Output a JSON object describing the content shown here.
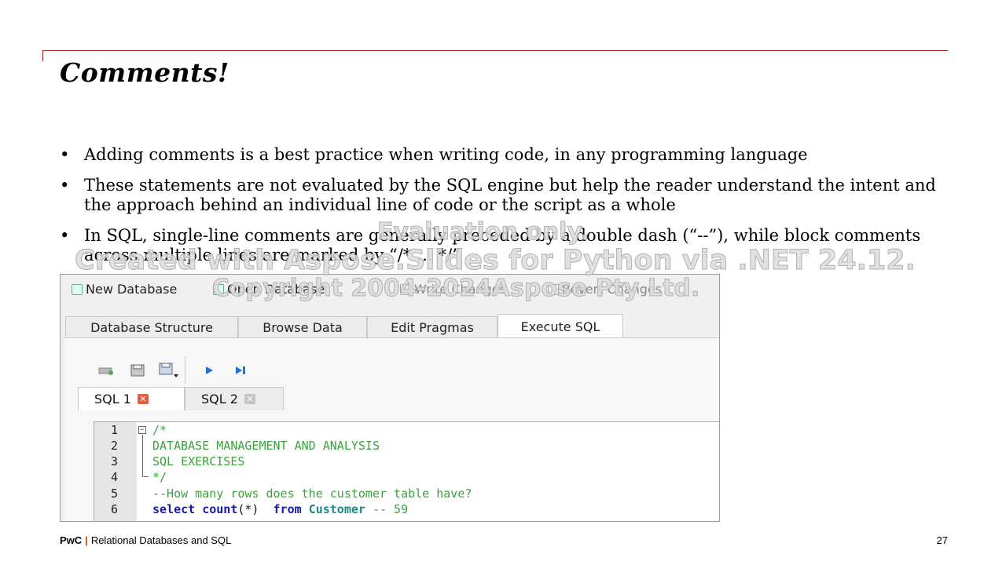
{
  "slide": {
    "title": "Comments!",
    "bullets": [
      "Adding comments is a best practice when writing code, in any programming language",
      "These statements are not evaluated by the SQL engine but help the reader understand the intent and the approach behind an individual line of code or the script as a whole",
      "In SQL, single-line comments are generally preceded by a double dash (“--”), while block comments across multiple lines are marked by “/* … */”"
    ],
    "bullet_symbol": "•",
    "footer_brand": "PwC",
    "footer_separator": "|",
    "footer_text": "Relational Databases and SQL",
    "page_number": "27"
  },
  "watermark": {
    "line1": "Evaluation only.",
    "line2": "Created with Aspose.Slides for Python via .NET 24.12.",
    "line3": "Copyright 2004-2024Aspose Pty Ltd."
  },
  "app": {
    "toolbar": {
      "new_database": "New Database",
      "open_database": "Open Database",
      "write_changes": "Write Changes",
      "revert_changes": "Revert Changes"
    },
    "tabs": [
      "Database Structure",
      "Browse Data",
      "Edit Pragmas",
      "Execute SQL"
    ],
    "active_tab": "Execute SQL",
    "sql_tabs": [
      "SQL 1",
      "SQL 2"
    ],
    "active_sql_tab": "SQL 1",
    "close_glyph": "✕",
    "icons": [
      "open-tab-icon",
      "open-sql-file-icon",
      "save-sql-file-icon",
      "execute-all-icon",
      "execute-line-icon"
    ],
    "editor": {
      "line_numbers": [
        "1",
        "2",
        "3",
        "4",
        "5",
        "6"
      ],
      "lines": {
        "l1": "/*",
        "l2": "DATABASE MANAGEMENT AND ANALYSIS",
        "l3": "SQL EXERCISES",
        "l4": "*/",
        "l5": "--How many rows does the customer table have?",
        "l6_kw1": "select",
        "l6_kw2": "count",
        "l6_args": "(*)",
        "l6_kw3": "from",
        "l6_table": "Customer",
        "l6_comment": "-- 59"
      }
    },
    "colors": {
      "comment": "#3aa33a",
      "keyword": "#1a1aa8",
      "identifier": "#1a8a8a",
      "accent": "#a32020"
    }
  }
}
